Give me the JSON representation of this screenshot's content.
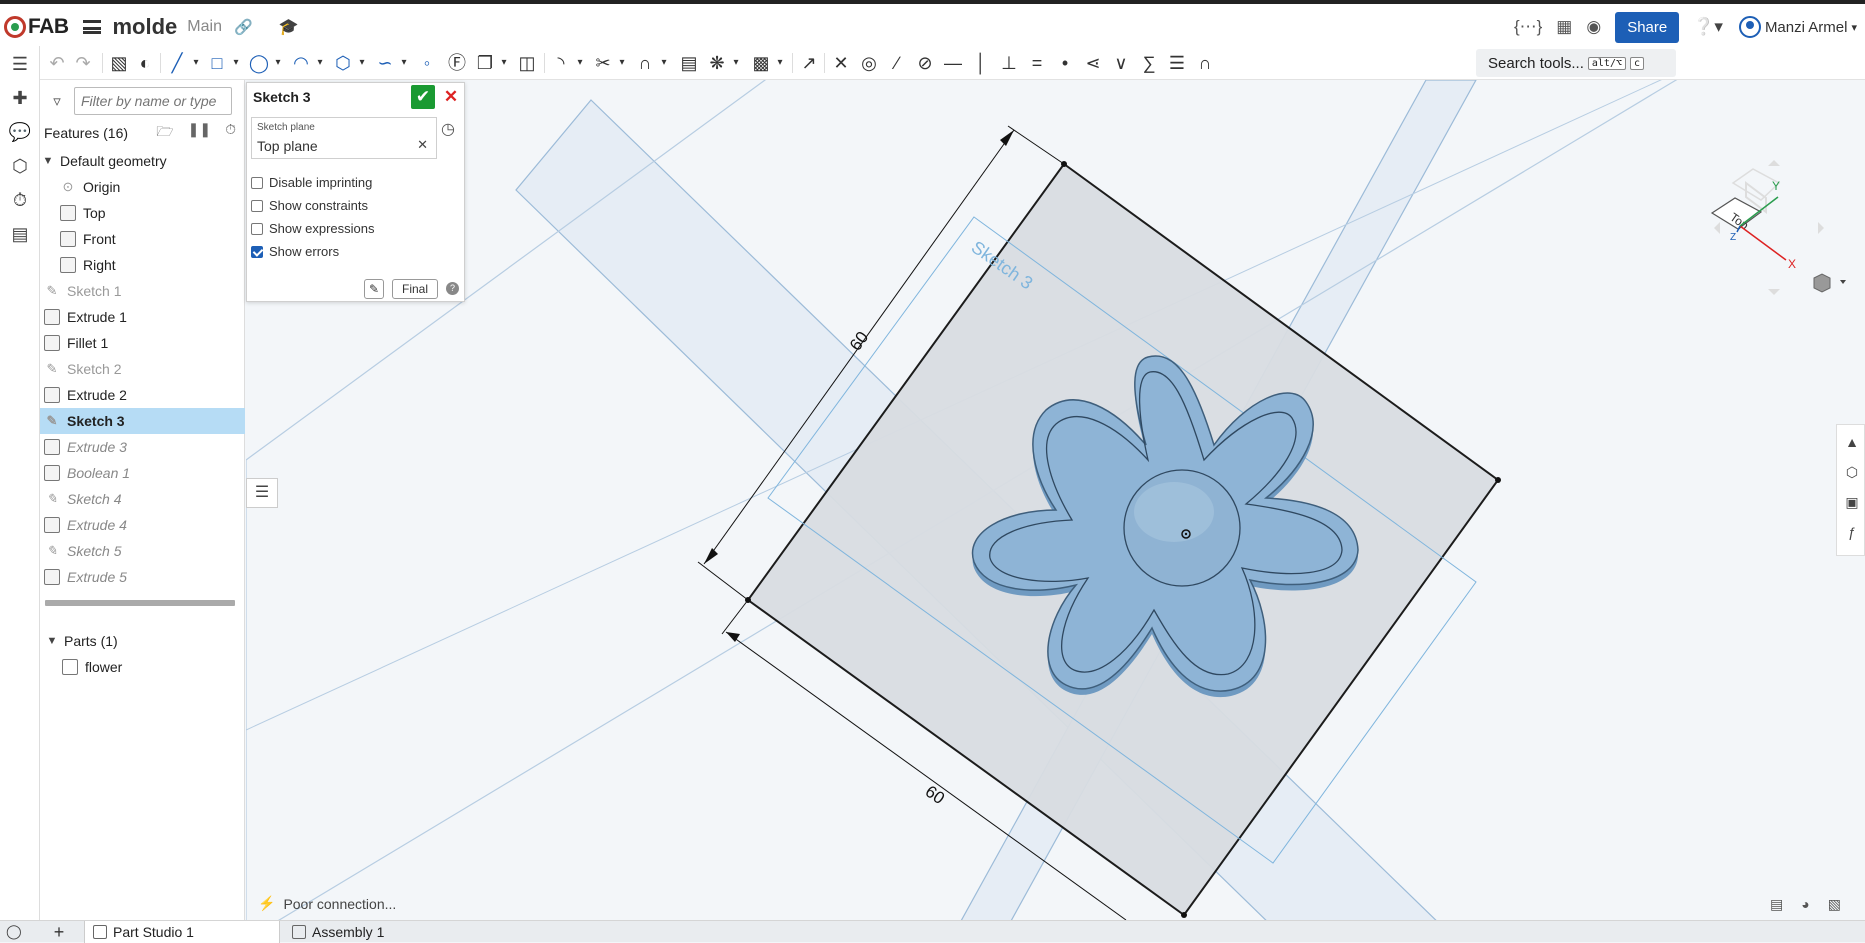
{
  "app": {
    "logo_text": "FAB",
    "document_title": "molde",
    "branch": "Main"
  },
  "header": {
    "share_label": "Share",
    "user_name": "Manzi Armel"
  },
  "toolbar": {
    "search_label": "Search tools...",
    "shortcut_1": "alt/⌥",
    "shortcut_2": "c"
  },
  "feature_panel": {
    "filter_placeholder": "Filter by name or type",
    "features_header": "Features (16)",
    "default_geometry": "Default geometry",
    "items": [
      {
        "label": "Origin"
      },
      {
        "label": "Top"
      },
      {
        "label": "Front"
      },
      {
        "label": "Right"
      },
      {
        "label": "Sketch 1"
      },
      {
        "label": "Extrude 1"
      },
      {
        "label": "Fillet 1"
      },
      {
        "label": "Sketch 2"
      },
      {
        "label": "Extrude 2"
      },
      {
        "label": "Sketch 3"
      },
      {
        "label": "Extrude 3"
      },
      {
        "label": "Boolean 1"
      },
      {
        "label": "Sketch 4"
      },
      {
        "label": "Extrude 4"
      },
      {
        "label": "Sketch 5"
      },
      {
        "label": "Extrude 5"
      }
    ],
    "parts_header": "Parts (1)",
    "part_name": "flower"
  },
  "sketch_dialog": {
    "title": "Sketch 3",
    "plane_label": "Sketch plane",
    "plane_value": "Top plane",
    "disable_imprinting": "Disable imprinting",
    "show_constraints": "Show constraints",
    "show_expressions": "Show expressions",
    "show_errors": "Show errors",
    "show_errors_checked": true,
    "final_label": "Final"
  },
  "viewport": {
    "dimension_1": "60",
    "dimension_2": "60",
    "sketch_label": "Sketch 3",
    "view_cube_face": "Top",
    "axis_x": "X",
    "axis_y": "Y",
    "axis_z": "Z",
    "face_color": "#d9dde2",
    "part_color": "#8eb4d6"
  },
  "status": {
    "connection": "Poor connection..."
  },
  "bottom_tabs": [
    {
      "label": "Part Studio 1"
    },
    {
      "label": "Assembly 1"
    }
  ]
}
